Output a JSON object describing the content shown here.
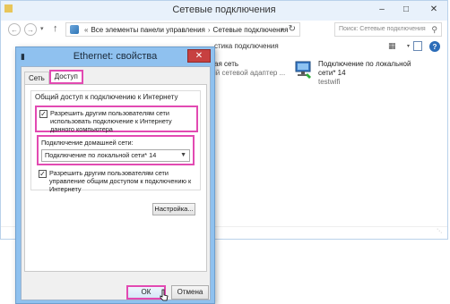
{
  "explorer": {
    "title": "Сетевые подключения",
    "breadcrumb": [
      "Все элементы панели управления",
      "Сетевые подключения"
    ],
    "search_placeholder": "Поиск: Сетевые подключения",
    "toolbar_text": "стика подключения",
    "connections": [
      {
        "name": "ая сеть",
        "detail": "ій сетевой адаптер ..."
      },
      {
        "name": "Подключение по локальной сети* 14",
        "detail": "testwifi"
      }
    ]
  },
  "dialog": {
    "title": "Ethernet: свойства",
    "tabs": [
      "Сеть",
      "Доступ"
    ],
    "active_tab": "Доступ",
    "group_title": "Общий доступ к подключению к Интернету",
    "allow_sharing": {
      "checked": true,
      "label": "Разрешить другим пользователям сети использовать подключение к Интернету данного компьютера"
    },
    "home_network_label": "Подключение домашней сети:",
    "home_network_value": "Подключение по локальной сети* 14",
    "allow_control": {
      "checked": true,
      "label": "Разрешить другим пользователям сети управление общим доступом к подключению к Интернету"
    },
    "settings_button": "Настройка...",
    "ok_button": "ОК",
    "cancel_button": "Отмена"
  },
  "colors": {
    "highlight": "#e24ab2",
    "dialog_frame": "#8fc1ef",
    "close_button": "#c74040"
  }
}
